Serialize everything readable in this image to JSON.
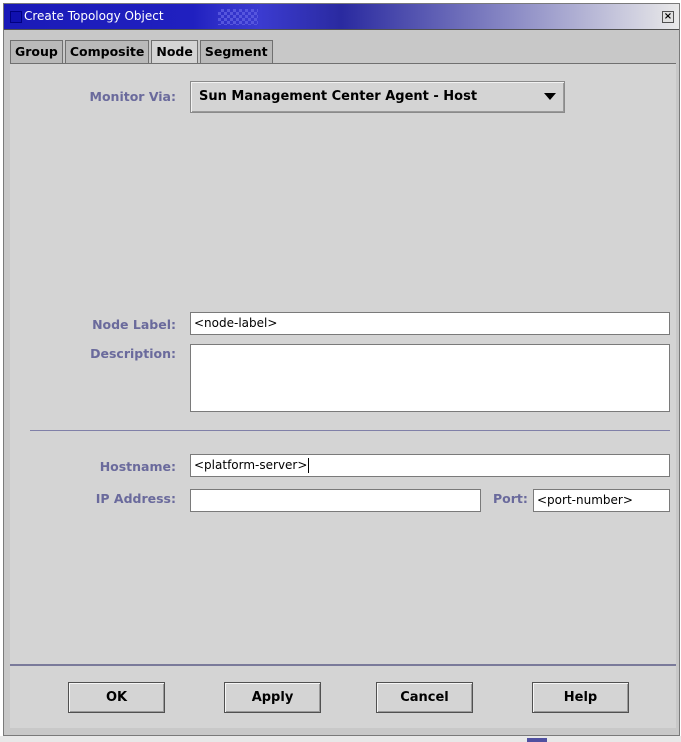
{
  "window": {
    "title": "Create Topology Object",
    "close_glyph": "×"
  },
  "tabs": [
    {
      "label": "Group",
      "active": false
    },
    {
      "label": "Composite",
      "active": false
    },
    {
      "label": "Node",
      "active": true
    },
    {
      "label": "Segment",
      "active": false
    }
  ],
  "form": {
    "monitor_via": {
      "label": "Monitor Via:",
      "value": "Sun Management Center Agent - Host"
    },
    "node_label": {
      "label": "Node Label:",
      "value": "<node-label>"
    },
    "description": {
      "label": "Description:",
      "value": ""
    },
    "hostname": {
      "label": "Hostname:",
      "value": "<platform-server>"
    },
    "ip_address": {
      "label": "IP Address:",
      "value": ""
    },
    "port": {
      "label": "Port:",
      "value": "<port-number>"
    }
  },
  "buttons": {
    "ok": "OK",
    "apply": "Apply",
    "cancel": "Cancel",
    "help": "Help"
  },
  "colors": {
    "label_text": "#6a6a9c",
    "title_bar": "#1a1ab8",
    "panel_bg": "#d4d4d4"
  }
}
